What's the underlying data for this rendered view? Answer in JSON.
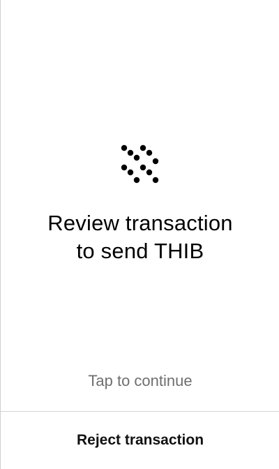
{
  "prompt": {
    "title_line1": "Review transaction",
    "title_line2": "to send THIB",
    "hint": "Tap to continue"
  },
  "actions": {
    "reject_label": "Reject transaction"
  },
  "icons": {
    "logo": "dot-grid-logo-icon"
  },
  "colors": {
    "text": "#000000",
    "hint": "#6f6f6f",
    "divider": "#d4d4d4",
    "background": "#ffffff"
  }
}
